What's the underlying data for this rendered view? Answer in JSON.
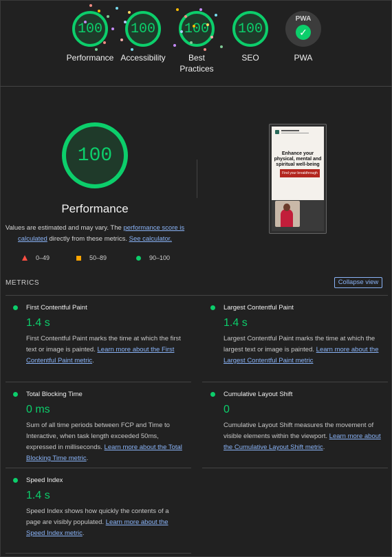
{
  "colors": {
    "pass": "#0cce6b",
    "average": "#ffa400",
    "fail": "#ff4e42",
    "link": "#8ab4f8",
    "background": "#212121"
  },
  "top_scores": [
    {
      "score": "100",
      "label": "Performance"
    },
    {
      "score": "100",
      "label": "Accessibility"
    },
    {
      "score": "100",
      "label": "Best Practices"
    },
    {
      "score": "100",
      "label": "SEO"
    }
  ],
  "pwa": {
    "badge_text": "PWA",
    "label": "PWA",
    "icon": "check-icon"
  },
  "performance": {
    "score": "100",
    "title": "Performance",
    "estimate_text_1": "Values are estimated and may vary. The ",
    "estimate_link_1": "performance score is calculated",
    "estimate_text_2": " directly from these metrics. ",
    "estimate_link_2": "See calculator."
  },
  "legend": [
    {
      "icon": "triangle-icon",
      "range": "0–49"
    },
    {
      "icon": "square-icon",
      "range": "50–89"
    },
    {
      "icon": "circle-icon",
      "range": "90–100"
    }
  ],
  "screenshot": {
    "headline": "Enhance your physical, mental and spiritual well-being",
    "cta": "Find your breakthrough"
  },
  "metrics_section": {
    "title": "METRICS",
    "collapse_label": "Collapse view"
  },
  "metrics": {
    "fcp": {
      "name": "First Contentful Paint",
      "value": "1.4 s",
      "desc": "First Contentful Paint marks the time at which the first text or image is painted. ",
      "link": "Learn more about the First Contentful Paint metric",
      "tail": "."
    },
    "lcp": {
      "name": "Largest Contentful Paint",
      "value": "1.4 s",
      "desc": "Largest Contentful Paint marks the time at which the largest text or image is painted. ",
      "link": "Learn more about the Largest Contentful Paint metric",
      "tail": ""
    },
    "tbt": {
      "name": "Total Blocking Time",
      "value": "0 ms",
      "desc": "Sum of all time periods between FCP and Time to Interactive, when task length exceeded 50ms, expressed in milliseconds. ",
      "link": "Learn more about the Total Blocking Time metric",
      "tail": "."
    },
    "cls": {
      "name": "Cumulative Layout Shift",
      "value": "0",
      "desc": "Cumulative Layout Shift measures the movement of visible elements within the viewport. ",
      "link": "Learn more about the Cumulative Layout Shift metric",
      "tail": "."
    },
    "si": {
      "name": "Speed Index",
      "value": "1.4 s",
      "desc": "Speed Index shows how quickly the contents of a page are visibly populated. ",
      "link": "Learn more about the Speed Index metric",
      "tail": "."
    }
  }
}
